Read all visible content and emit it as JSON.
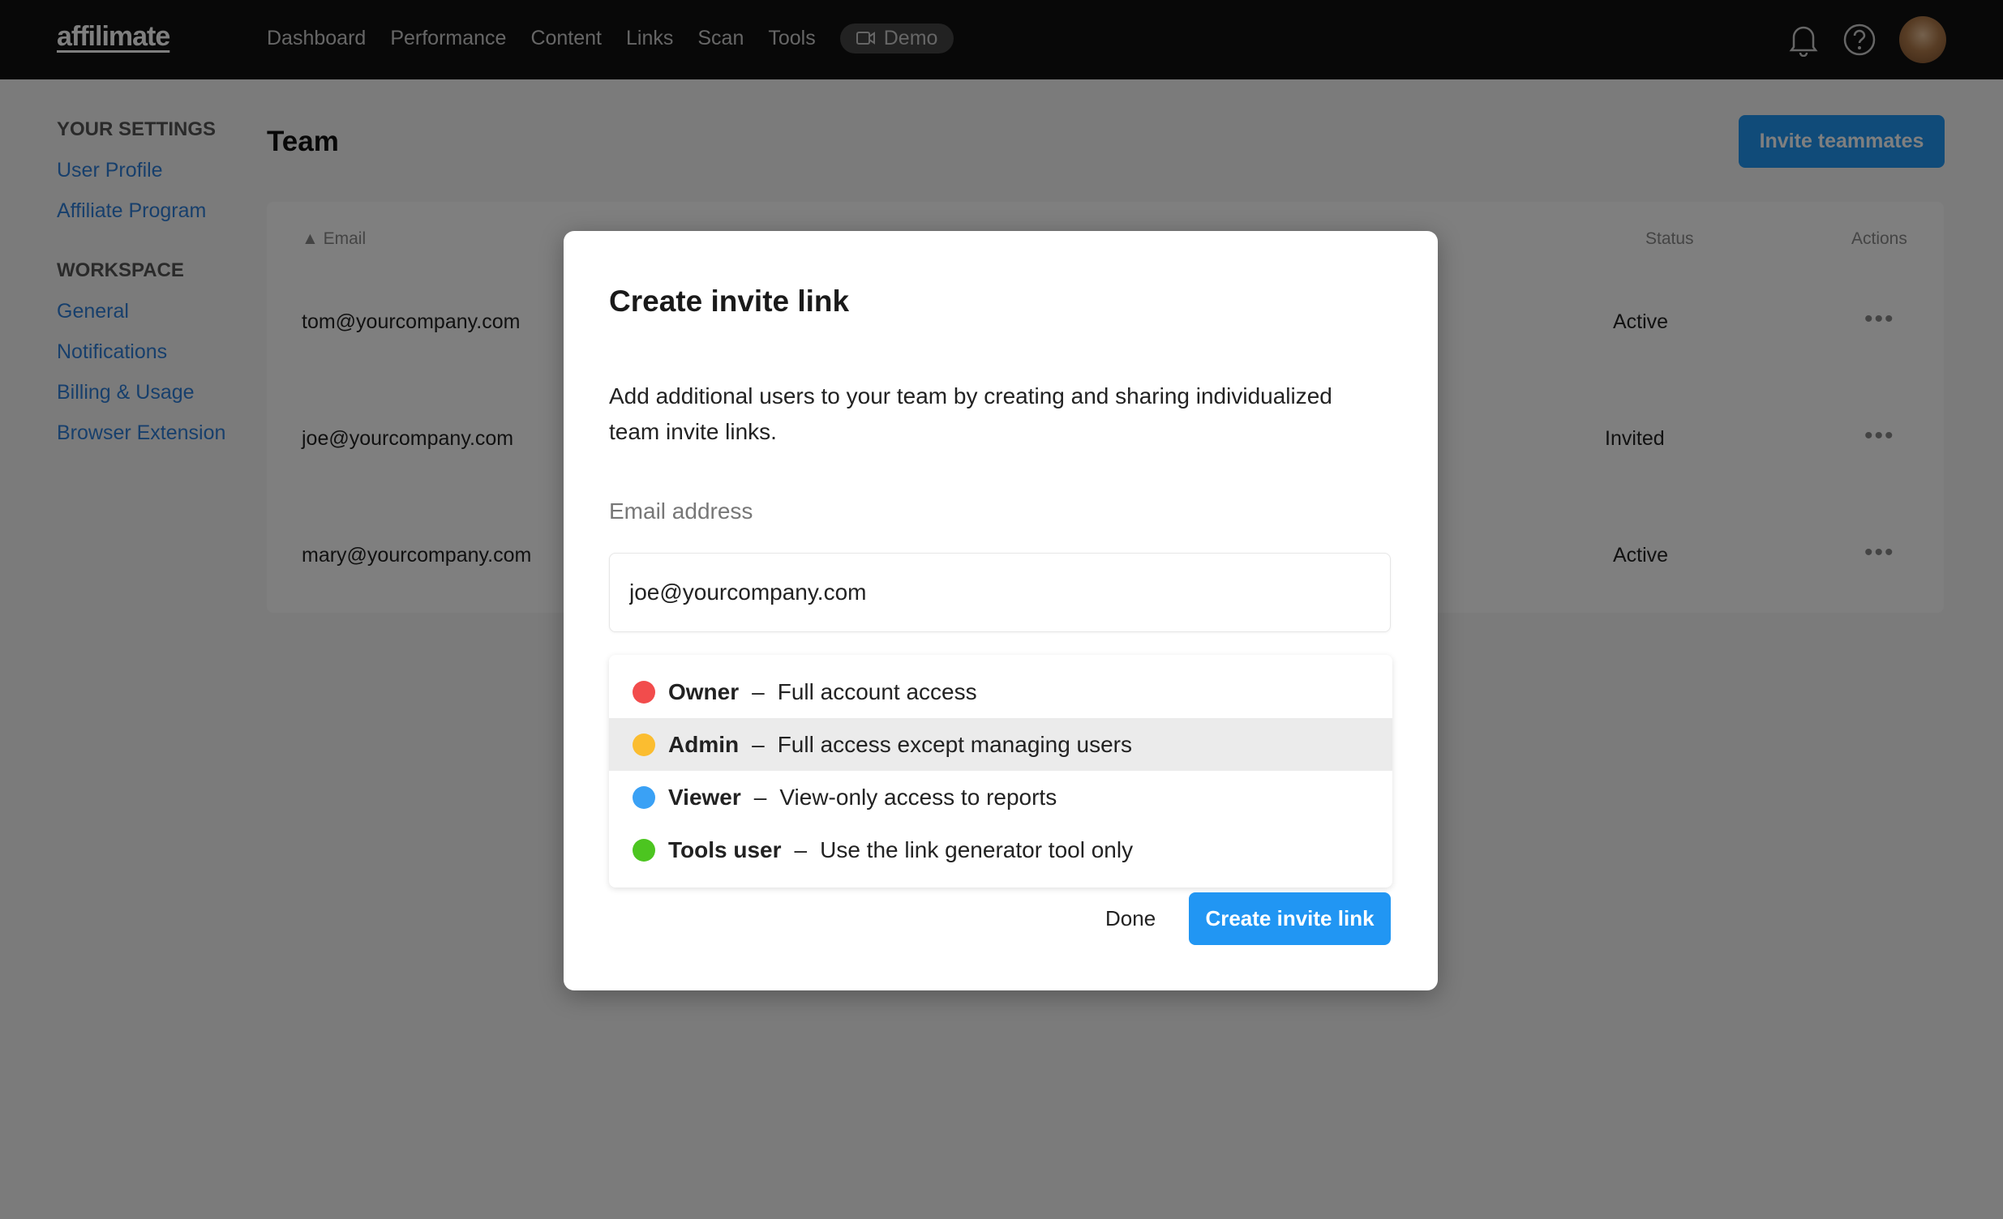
{
  "header": {
    "logo": "affilimate",
    "nav": [
      "Dashboard",
      "Performance",
      "Content",
      "Links",
      "Scan",
      "Tools"
    ],
    "demo": "Demo"
  },
  "sidebar": {
    "settings_heading": "YOUR SETTINGS",
    "settings": [
      "User Profile",
      "Affiliate Program"
    ],
    "workspace_heading": "WORKSPACE",
    "workspace": [
      "General",
      "Notifications",
      "Billing & Usage",
      "Browser Extension"
    ]
  },
  "page": {
    "title": "Team",
    "invite_button": "Invite teammates"
  },
  "table": {
    "columns": {
      "email": "Email",
      "status": "Status",
      "actions": "Actions"
    },
    "rows": [
      {
        "email": "tom@yourcompany.com",
        "status": "Active"
      },
      {
        "email": "joe@yourcompany.com",
        "status": "Invited"
      },
      {
        "email": "mary@yourcompany.com",
        "status": "Active"
      }
    ],
    "more": "•••"
  },
  "modal": {
    "title": "Create invite link",
    "description": "Add additional users to your team by creating and sharing individualized team invite links.",
    "email_label": "Email address",
    "email_value": "joe@yourcompany.com",
    "roles": [
      {
        "name": "Owner",
        "desc": "Full account access",
        "color": "#f24c4c"
      },
      {
        "name": "Admin",
        "desc": "Full access except managing users",
        "color": "#fbbd30"
      },
      {
        "name": "Viewer",
        "desc": "View-only access to reports",
        "color": "#3aa1f5"
      },
      {
        "name": "Tools user",
        "desc": "Use the link generator tool only",
        "color": "#4cc520"
      }
    ],
    "highlighted_role": "Admin",
    "dash": "–",
    "done": "Done",
    "create": "Create invite link"
  },
  "colors": {
    "accent": "#2196f3"
  }
}
